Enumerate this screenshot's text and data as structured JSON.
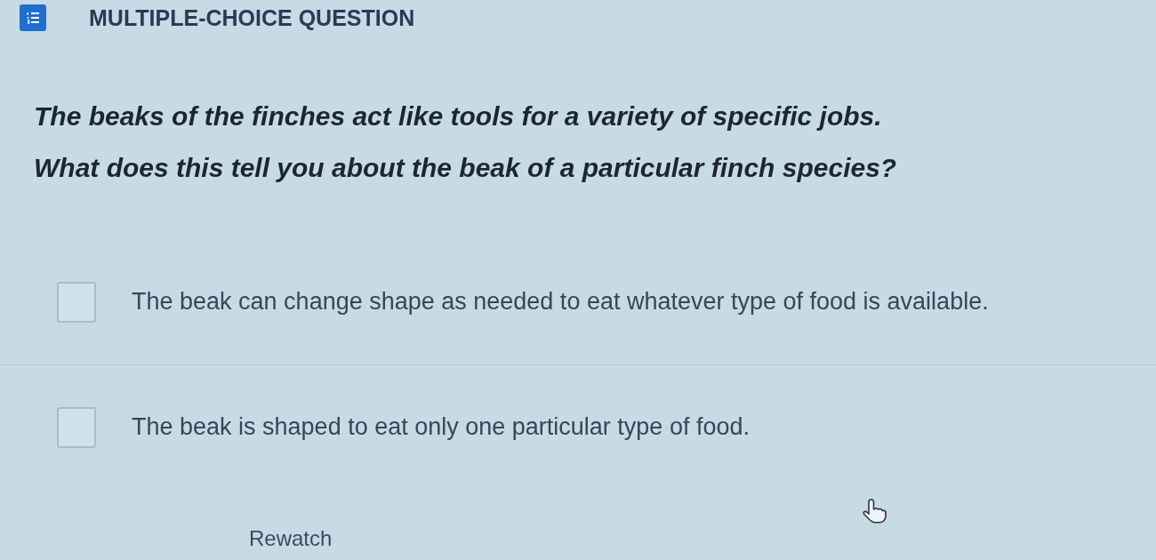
{
  "header": {
    "title": "MULTIPLE-CHOICE QUESTION"
  },
  "question": {
    "lines": [
      "The beaks of the finches act like tools for a variety of specific jobs.",
      "What does this tell you about the beak of a particular finch species?"
    ]
  },
  "options": [
    {
      "text": "The beak can change shape as needed to eat whatever type of food is available.",
      "selected": false
    },
    {
      "text": "The beak is shaped to eat only one particular type of food.",
      "selected": false
    }
  ],
  "rewatch": {
    "label": "Rewatch"
  }
}
